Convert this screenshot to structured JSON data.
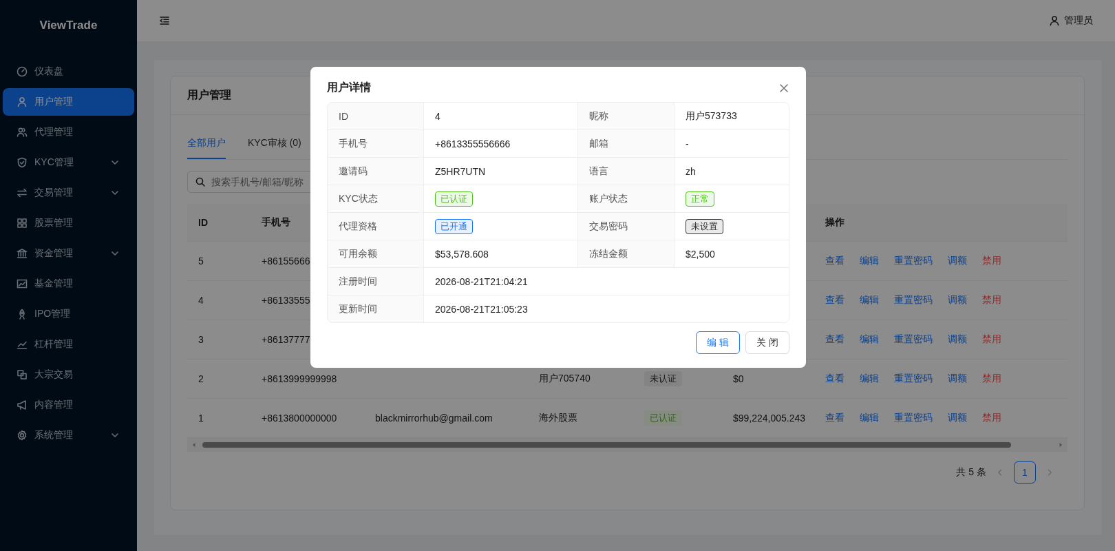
{
  "sidebar": {
    "logo": "ViewTrade",
    "items": [
      {
        "label": "仪表盘",
        "selected": false,
        "expandable": false
      },
      {
        "label": "用户管理",
        "selected": true,
        "expandable": false
      },
      {
        "label": "代理管理",
        "selected": false,
        "expandable": false
      },
      {
        "label": "KYC管理",
        "selected": false,
        "expandable": true
      },
      {
        "label": "交易管理",
        "selected": false,
        "expandable": true
      },
      {
        "label": "股票管理",
        "selected": false,
        "expandable": false
      },
      {
        "label": "资金管理",
        "selected": false,
        "expandable": true
      },
      {
        "label": "基金管理",
        "selected": false,
        "expandable": false
      },
      {
        "label": "IPO管理",
        "selected": false,
        "expandable": false
      },
      {
        "label": "杠杆管理",
        "selected": false,
        "expandable": false
      },
      {
        "label": "大宗交易",
        "selected": false,
        "expandable": false
      },
      {
        "label": "内容管理",
        "selected": false,
        "expandable": false
      },
      {
        "label": "系统管理",
        "selected": false,
        "expandable": true
      }
    ]
  },
  "header": {
    "user": "管理员"
  },
  "page": {
    "title": "用户管理",
    "tabs": [
      {
        "label": "全部用户",
        "selected": true
      },
      {
        "label": "KYC审核 (0)",
        "selected": false
      }
    ],
    "search": {
      "placeholder": "搜索手机号/邮箱/昵称"
    },
    "table": {
      "columns": [
        "ID",
        "手机号",
        "操作"
      ],
      "rows": [
        {
          "id": "5",
          "phone": "+86155666",
          "actions": [
            {
              "label": "查看",
              "kind": "link"
            },
            {
              "label": "编辑",
              "kind": "link"
            },
            {
              "label": "重置密码",
              "kind": "link"
            },
            {
              "label": "调额",
              "kind": "link"
            },
            {
              "label": "禁用",
              "kind": "danger"
            }
          ]
        },
        {
          "id": "4",
          "phone": "+86133555",
          "actions": [
            {
              "label": "查看",
              "kind": "link"
            },
            {
              "label": "编辑",
              "kind": "link"
            },
            {
              "label": "重置密码",
              "kind": "link"
            },
            {
              "label": "调额",
              "kind": "link"
            },
            {
              "label": "禁用",
              "kind": "danger"
            }
          ]
        },
        {
          "id": "3",
          "phone": "+86137777",
          "actions": [
            {
              "label": "查看",
              "kind": "link"
            },
            {
              "label": "编辑",
              "kind": "link"
            },
            {
              "label": "重置密码",
              "kind": "link"
            },
            {
              "label": "调额",
              "kind": "link"
            },
            {
              "label": "禁用",
              "kind": "danger"
            }
          ]
        },
        {
          "id": "2",
          "phone": "+8613999999998",
          "nickname": "用户705740",
          "kyc": {
            "text": "未认证",
            "kind": "neutral"
          },
          "balance": "$0",
          "actions": [
            {
              "label": "查看",
              "kind": "link"
            },
            {
              "label": "编辑",
              "kind": "link"
            },
            {
              "label": "重置密码",
              "kind": "link"
            },
            {
              "label": "调额",
              "kind": "link"
            },
            {
              "label": "禁用",
              "kind": "danger"
            }
          ]
        },
        {
          "id": "1",
          "phone": "+8613800000000",
          "email": "blackmirrorhub@gmail.com",
          "nickname": "海外股票",
          "kyc": {
            "text": "已认证",
            "kind": "success"
          },
          "balance": "$99,224,005.243",
          "actions": [
            {
              "label": "查看",
              "kind": "link"
            },
            {
              "label": "编辑",
              "kind": "link"
            },
            {
              "label": "重置密码",
              "kind": "link"
            },
            {
              "label": "调额",
              "kind": "link"
            },
            {
              "label": "禁用",
              "kind": "danger"
            }
          ]
        }
      ]
    },
    "pagination": {
      "total": "共 5 条",
      "pages": [
        {
          "label": "1",
          "selected": true
        }
      ]
    }
  },
  "modal": {
    "title": "用户详情",
    "rows": [
      [
        {
          "label": "ID",
          "value": {
            "kind": "text",
            "text": "4"
          }
        },
        {
          "label": "昵称",
          "value": {
            "kind": "text",
            "text": "用户573733"
          }
        }
      ],
      [
        {
          "label": "手机号",
          "value": {
            "kind": "text",
            "text": "+8613355556666"
          }
        },
        {
          "label": "邮箱",
          "value": {
            "kind": "text",
            "text": "-"
          }
        }
      ],
      [
        {
          "label": "邀请码",
          "value": {
            "kind": "text",
            "text": "Z5HR7UTN"
          }
        },
        {
          "label": "语言",
          "value": {
            "kind": "text",
            "text": "zh"
          }
        }
      ],
      [
        {
          "label": "KYC状态",
          "value": {
            "kind": "tag",
            "text": "已认证",
            "color": "#52c41a"
          }
        },
        {
          "label": "账户状态",
          "value": {
            "kind": "tag",
            "text": "正常",
            "color": "#52c41a"
          }
        }
      ],
      [
        {
          "label": "代理资格",
          "value": {
            "kind": "tag",
            "text": "已开通",
            "color": "#1677ff"
          }
        },
        {
          "label": "交易密码",
          "value": {
            "kind": "tag",
            "text": "未设置",
            "color": "#333333"
          }
        }
      ],
      [
        {
          "label": "可用余额",
          "value": {
            "kind": "text",
            "text": "$53,578.608"
          }
        },
        {
          "label": "冻结金额",
          "value": {
            "kind": "text",
            "text": "$2,500"
          }
        }
      ],
      [
        {
          "label": "注册时间",
          "value": {
            "kind": "text",
            "text": "2026-08-21T21:04:21"
          }
        }
      ],
      [
        {
          "label": "更新时间",
          "value": {
            "kind": "text",
            "text": "2026-08-21T21:05:23"
          }
        }
      ]
    ],
    "buttons": [
      {
        "label": "编 辑",
        "kind": "primary"
      },
      {
        "label": "关 闭",
        "kind": "default"
      }
    ]
  }
}
